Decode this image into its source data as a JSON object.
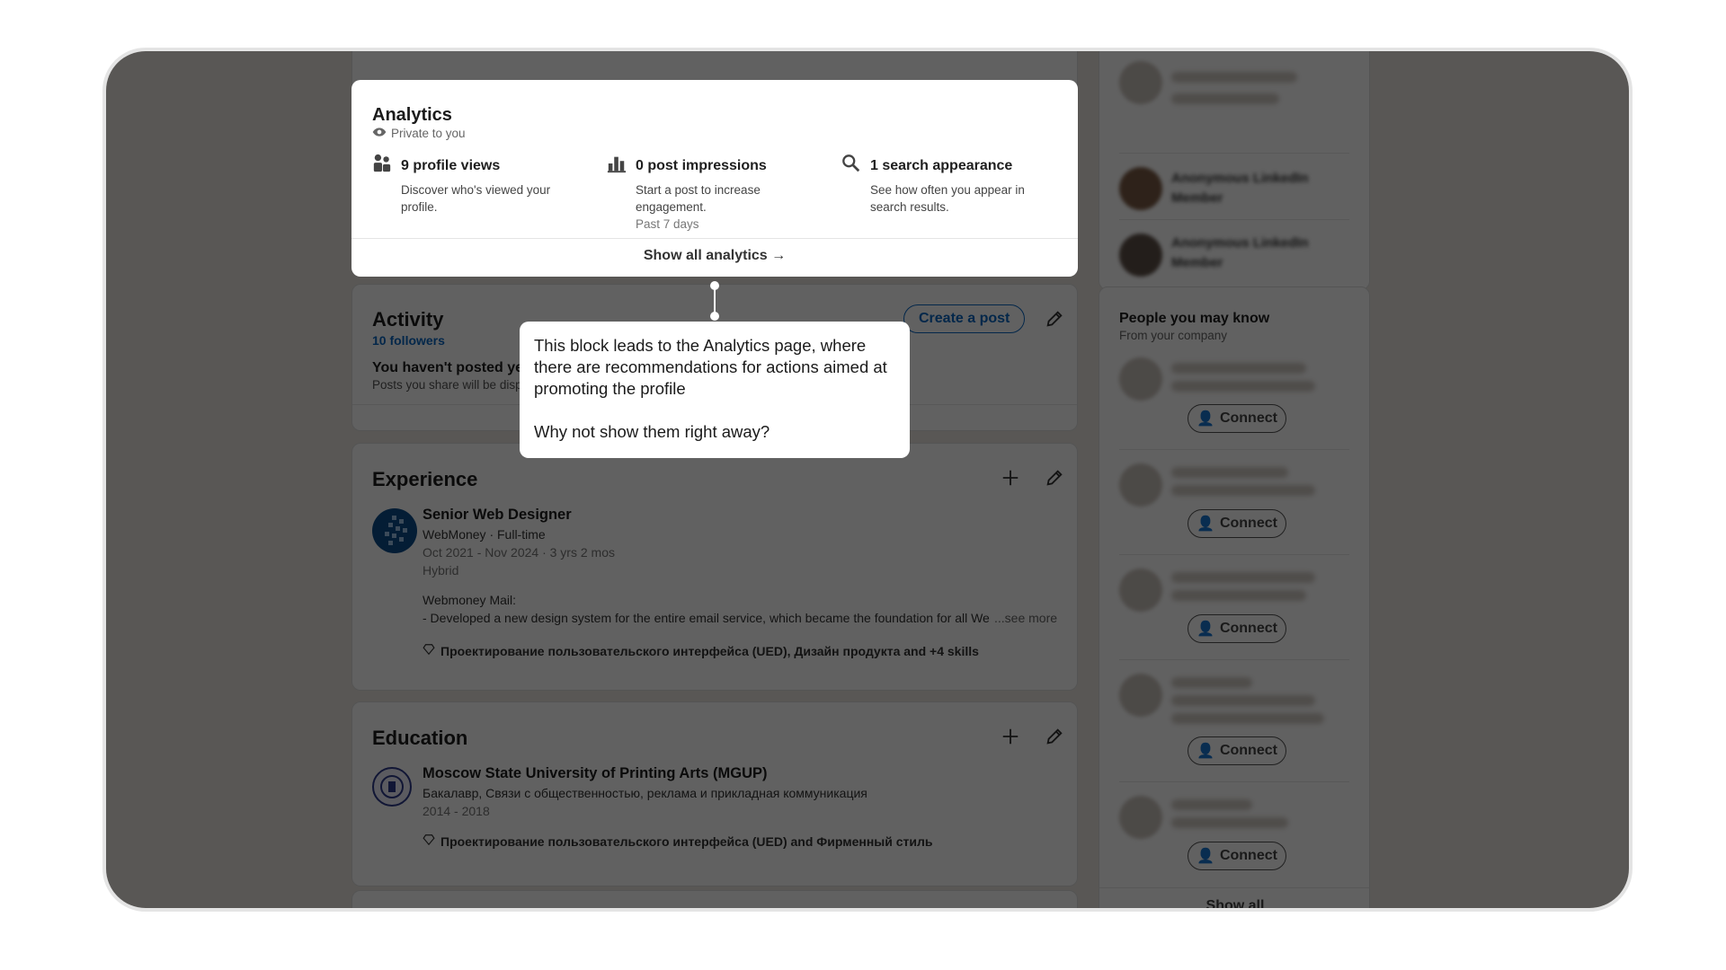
{
  "analytics": {
    "title": "Analytics",
    "privacy": "Private to you",
    "metrics": [
      {
        "icon": "people-icon",
        "title": "9 profile views",
        "desc": "Discover who's viewed your profile.",
        "meta": ""
      },
      {
        "icon": "bar-chart-icon",
        "title": "0 post impressions",
        "desc": "Start a post to increase engagement.",
        "meta": "Past 7 days"
      },
      {
        "icon": "search-icon",
        "title": "1 search appearance",
        "desc": "See how often you appear in search results.",
        "meta": ""
      }
    ],
    "show_all": "Show all analytics →"
  },
  "tooltip": {
    "line1": "This block leads to the Analytics page, where there are recommendations for actions aimed at promoting the profile",
    "line2": "Why not show them right away?"
  },
  "activity": {
    "title": "Activity",
    "followers": "10 followers",
    "create_post": "Create a post",
    "empty_title": "You haven't posted yet",
    "empty_desc": "Posts you share will be displayed here."
  },
  "experience": {
    "title": "Experience",
    "role": "Senior Web Designer",
    "company": "WebMoney · Full-time",
    "dates": "Oct 2021 - Nov 2024 · 3 yrs 2 mos",
    "location": "Hybrid",
    "desc_title": "Webmoney Mail:",
    "desc_line": "- Developed a new design system for the entire email service, which became the foundation for all We",
    "see_more": "...see more",
    "skills": "Проектирование пользовательского интерфейса (UED), Дизайн продукта and +4 skills"
  },
  "education": {
    "title": "Education",
    "school": "Moscow State University of Printing Arts (MGUP)",
    "degree": "Бакалавр, Связи с общественностью, реклама и прикладная коммуникация",
    "years": "2014 - 2018",
    "skills": "Проектирование пользовательского интерфейса (UED) and Фирменный стиль"
  },
  "sidebar": {
    "anon_member": "Anonymous LinkedIn Member",
    "pymk_title": "People you may know",
    "pymk_sub": "From your company",
    "connect_label": "Connect",
    "show_all": "Show all"
  },
  "colors": {
    "accent": "#0a66c2",
    "overlay": "#000000"
  }
}
